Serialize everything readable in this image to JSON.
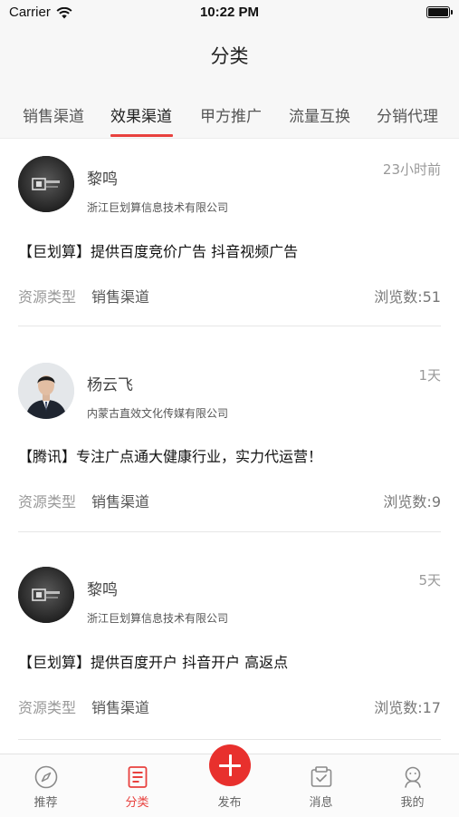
{
  "status_bar": {
    "carrier": "Carrier",
    "time": "10:22 PM"
  },
  "nav": {
    "title": "分类"
  },
  "tabs": [
    {
      "label": "销售渠道"
    },
    {
      "label": "效果渠道",
      "active": true
    },
    {
      "label": "甲方推广"
    },
    {
      "label": "流量互换"
    },
    {
      "label": "分销代理"
    }
  ],
  "posts": [
    {
      "name": "黎鸣",
      "company": "浙江巨划算信息技术有限公司",
      "time_ago": "23小时前",
      "title": "【巨划算】提供百度竞价广告 抖音视频广告",
      "resource_label": "资源类型",
      "resource_type": "销售渠道",
      "views": "浏览数:51",
      "avatar": "logo-avatar"
    },
    {
      "name": "杨云飞",
      "company": "内蒙古直效文化传媒有限公司",
      "time_ago": "1天",
      "title": "【腾讯】专注广点通大健康行业，实力代运营！",
      "resource_label": "资源类型",
      "resource_type": "销售渠道",
      "views": "浏览数:9",
      "avatar": "person-avatar"
    },
    {
      "name": "黎鸣",
      "company": "浙江巨划算信息技术有限公司",
      "time_ago": "5天",
      "title": "【巨划算】提供百度开户 抖音开户 高返点",
      "resource_label": "资源类型",
      "resource_type": "销售渠道",
      "views": "浏览数:17",
      "avatar": "logo-avatar"
    }
  ],
  "tab_bar": [
    {
      "label": "推荐",
      "icon": "compass-icon"
    },
    {
      "label": "分类",
      "icon": "document-icon",
      "active": true
    },
    {
      "label": "发布",
      "icon": "plus-icon"
    },
    {
      "label": "消息",
      "icon": "message-check-icon"
    },
    {
      "label": "我的",
      "icon": "profile-icon"
    }
  ],
  "colors": {
    "accent": "#e8413e",
    "publish_button": "#e8302d"
  }
}
